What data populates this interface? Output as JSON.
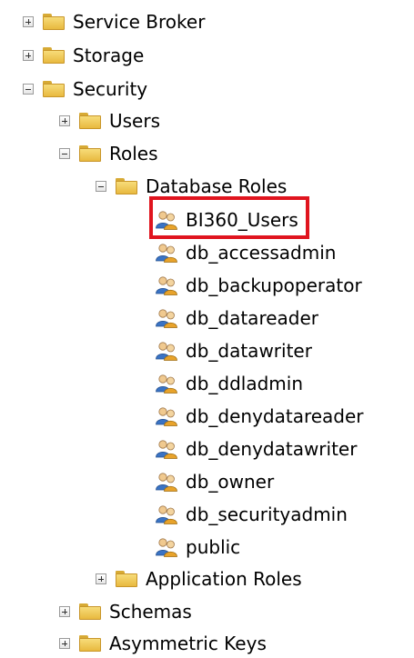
{
  "tree": {
    "service_broker": "Service Broker",
    "storage": "Storage",
    "security": "Security",
    "users": "Users",
    "roles": "Roles",
    "database_roles": "Database Roles",
    "roles_list": [
      "BI360_Users",
      "db_accessadmin",
      "db_backupoperator",
      "db_datareader",
      "db_datawriter",
      "db_ddladmin",
      "db_denydatareader",
      "db_denydatawriter",
      "db_owner",
      "db_securityadmin",
      "public"
    ],
    "application_roles": "Application Roles",
    "schemas": "Schemas",
    "asymmetric_keys": "Asymmetric Keys"
  },
  "highlight_color": "#e0141e"
}
